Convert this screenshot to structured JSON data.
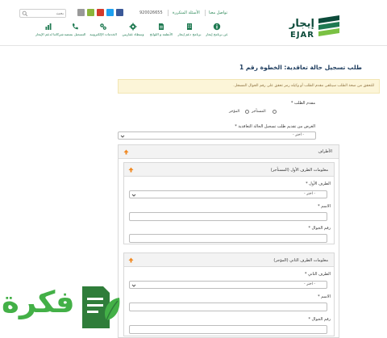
{
  "header": {
    "search_placeholder": "بحث",
    "contact_link": "تواصل معنا",
    "faq_link": "الأسئلة المتكررة",
    "phone": "920026655",
    "logo_arabic": "إيجار",
    "logo_english": "EJAR",
    "nav": [
      {
        "label": "عن برنامج إيجار",
        "icon": "info-icon"
      },
      {
        "label": "برنامج دعم إيجار",
        "icon": "building-icon"
      },
      {
        "label": "الأنظمة و اللوائح",
        "icon": "document-icon"
      },
      {
        "label": "وسطاء عقاريين",
        "icon": "gear-icon"
      },
      {
        "label": "الخدمات الإلكترونية",
        "icon": "services-icon"
      },
      {
        "label": "التسجيل بمنصة",
        "icon": "phone-icon"
      },
      {
        "label": "شركائنا لدعم الإيجار",
        "icon": "chart-icon"
      }
    ],
    "social": [
      {
        "name": "facebook-icon",
        "color": "#3b5998"
      },
      {
        "name": "twitter-icon",
        "color": "#1da1f2"
      },
      {
        "name": "youtube-icon",
        "color": "#d33a2c"
      },
      {
        "name": "android-icon",
        "color": "#8ab43a"
      },
      {
        "name": "apple-icon",
        "color": "#999999"
      }
    ]
  },
  "form": {
    "title": "طلب تسجيل حالة تعاقدية: الخطوة رقم 1",
    "alert": "للتحقق من صحة الطلب سيتلقى مقدم الطلب أو وكيله رمز تحقق على رقم الجوال المسجل.",
    "applicant_label": "مقدم الطلب *",
    "applicant_options": [
      "المستأجر",
      "المؤجر"
    ],
    "purpose_label": "الغرض من تقديم طلب تسجيل الحالة التعاقدية *",
    "purpose_value": "- اختر -",
    "parties_title": "الأطراف",
    "party1": {
      "title": "معلومات الطرف الأول (المستأجر)",
      "party_label": "الطرف الأول *",
      "party_value": "- اختر -",
      "name_label": "الاسم *",
      "mobile_label": "رقم الجوال *"
    },
    "party2": {
      "title": "معلومات الطرف الثاني (المؤجر)",
      "party_label": "الطرف الثاني *",
      "party_value": "- اختر -",
      "name_label": "الاسم *",
      "mobile_label": "رقم الجوال *"
    }
  },
  "watermark": {
    "text": "فكرة"
  },
  "colors": {
    "accent_green": "#1f7a52",
    "title_blue": "#1b3a5c",
    "alert_bg": "#fcf5d8",
    "arrow_orange": "#f08a24"
  }
}
